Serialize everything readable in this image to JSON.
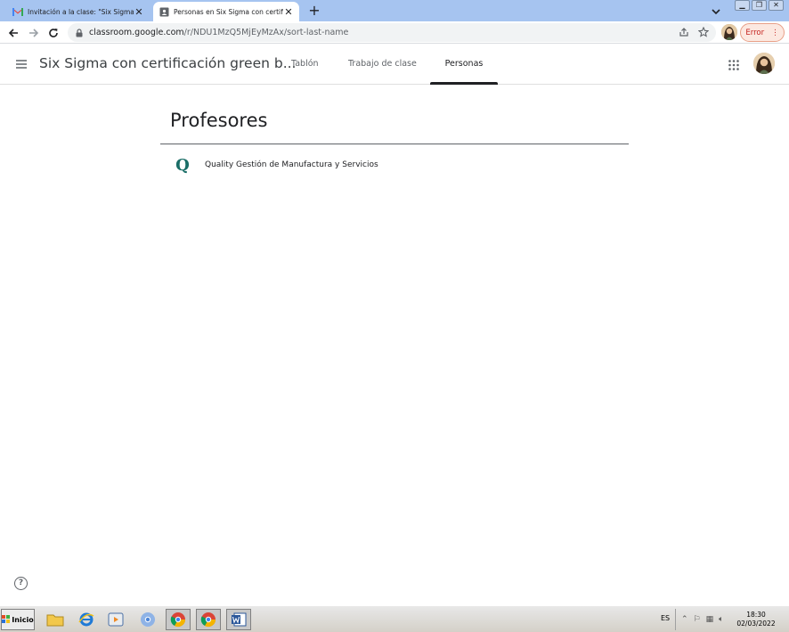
{
  "browser": {
    "tabs": [
      {
        "title": "Invitación a la clase: \"Six Sigma con certificación green belt\"",
        "icon": "gmail-icon",
        "active": false
      },
      {
        "title": "Personas en Six Sigma con certificación green belt",
        "icon": "classroom-tab-icon",
        "active": true
      }
    ],
    "new_tab_label": "+",
    "url_host": "classroom.google.com",
    "url_path": "/r/NDU1MzQ5MjEyMzAx/sort-last-name",
    "error_label": "Error",
    "accent": "#a6c4f0"
  },
  "app": {
    "class_title": "Six Sigma con certificación green b...",
    "tabs": [
      {
        "label": "Tablón",
        "active": false
      },
      {
        "label": "Trabajo de clase",
        "active": false
      },
      {
        "label": "Personas",
        "active": true
      }
    ]
  },
  "main": {
    "section_title": "Profesores",
    "teachers": [
      {
        "logo_letter": "Q",
        "name": "Quality Gestión de Manufactura y Servicios"
      }
    ],
    "help_label": "?"
  },
  "taskbar": {
    "start_label": "Inicio",
    "language": "ES",
    "time": "18:30",
    "date": "02/03/2022"
  }
}
